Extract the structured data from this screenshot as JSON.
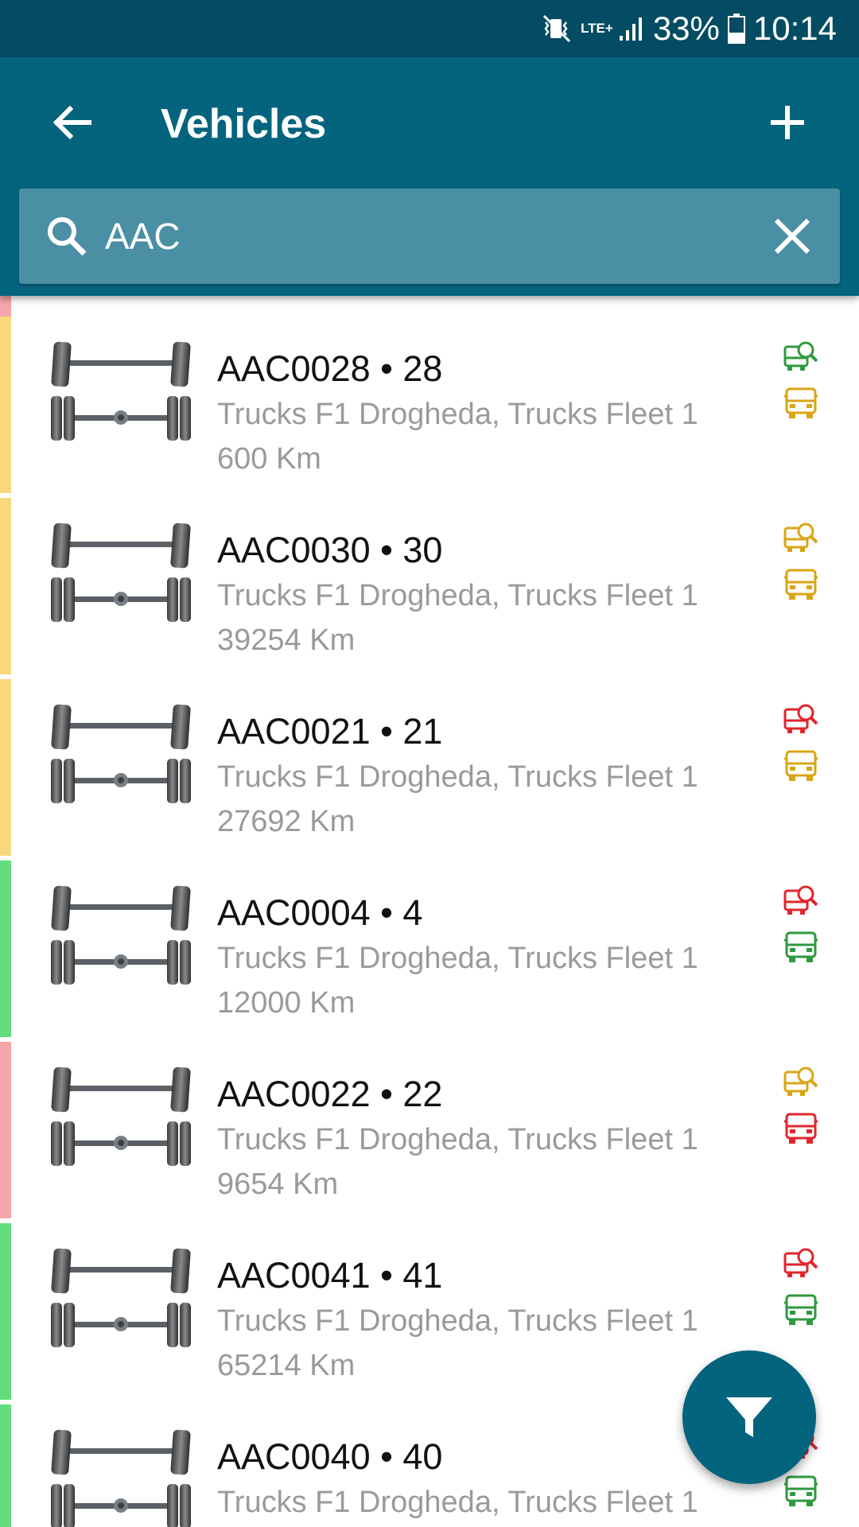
{
  "status_bar": {
    "network": "LTE+",
    "battery": "33%",
    "time": "10:14",
    "icons": [
      "mute-vibrate-icon",
      "lte-icon",
      "signal-icon",
      "battery-icon"
    ]
  },
  "header": {
    "title": "Vehicles",
    "back_icon": "arrow-back-icon",
    "add_icon": "plus-icon"
  },
  "search": {
    "value": "AAC",
    "icon": "search-icon",
    "clear_icon": "close-icon"
  },
  "colors": {
    "status_bar": "#044c63",
    "app_bar": "#04647e",
    "search_bg": "#4a8fa3",
    "green": "#2e9a3e",
    "yellow": "#d9a514",
    "red": "#e0262e",
    "strip_yellow": "#f8d87c",
    "strip_green": "#62de7c",
    "strip_red": "#f4a6a8"
  },
  "vehicles": [
    {
      "name": "AAC0028 • 28",
      "fleet": "Trucks F1 Drogheda, Trucks Fleet 1",
      "km": "600 Km",
      "strip": "yellow",
      "inspection_status": "green",
      "vehicle_status": "yellow"
    },
    {
      "name": "AAC0030 • 30",
      "fleet": "Trucks F1 Drogheda, Trucks Fleet 1",
      "km": "39254 Km",
      "strip": "yellow",
      "inspection_status": "yellow",
      "vehicle_status": "yellow"
    },
    {
      "name": "AAC0021 • 21",
      "fleet": "Trucks F1 Drogheda, Trucks Fleet 1",
      "km": "27692 Km",
      "strip": "yellow",
      "inspection_status": "red",
      "vehicle_status": "yellow"
    },
    {
      "name": "AAC0004 • 4",
      "fleet": "Trucks F1 Drogheda, Trucks Fleet 1",
      "km": "12000 Km",
      "strip": "green",
      "inspection_status": "red",
      "vehicle_status": "green"
    },
    {
      "name": "AAC0022 • 22",
      "fleet": "Trucks F1 Drogheda, Trucks Fleet 1",
      "km": "9654 Km",
      "strip": "red",
      "inspection_status": "yellow",
      "vehicle_status": "red"
    },
    {
      "name": "AAC0041 • 41",
      "fleet": "Trucks F1 Drogheda, Trucks Fleet 1",
      "km": "65214 Km",
      "strip": "green",
      "inspection_status": "red",
      "vehicle_status": "green"
    },
    {
      "name": "AAC0040 • 40",
      "fleet": "Trucks F1 Drogheda, Trucks Fleet 1",
      "km": "",
      "strip": "green",
      "inspection_status": "red",
      "vehicle_status": "green"
    }
  ],
  "fab": {
    "icon": "filter-icon"
  }
}
